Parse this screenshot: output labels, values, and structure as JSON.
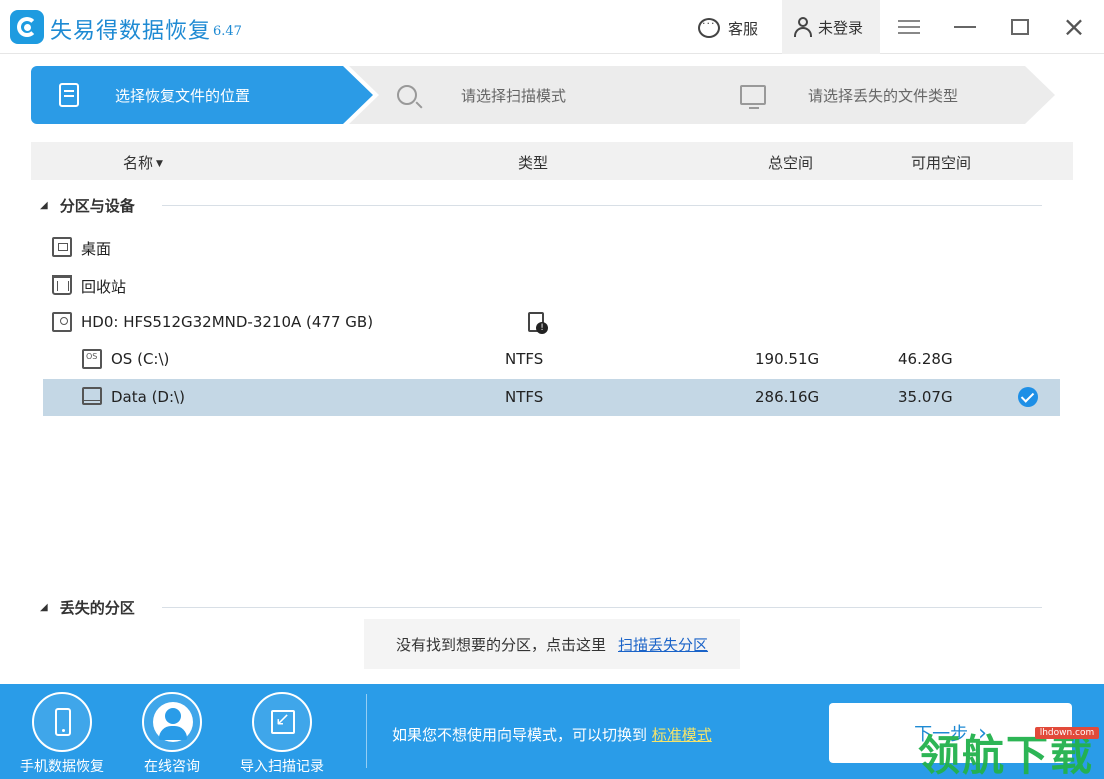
{
  "app": {
    "title": "失易得数据恢复",
    "version": "6.47",
    "service_label": "客服",
    "login_label": "未登录"
  },
  "steps": [
    {
      "label": "选择恢复文件的位置",
      "icon": "document-icon",
      "active": true
    },
    {
      "label": "请选择扫描模式",
      "icon": "magnifier-icon",
      "active": false
    },
    {
      "label": "请选择丢失的文件类型",
      "icon": "monitor-icon",
      "active": false
    }
  ],
  "table": {
    "headers": {
      "name": "名称",
      "type": "类型",
      "total": "总空间",
      "available": "可用空间"
    }
  },
  "sections": {
    "partitions": "分区与设备",
    "lost": "丢失的分区"
  },
  "rows": [
    {
      "name": "桌面",
      "icon": "desktop-icon",
      "type": "",
      "total": "",
      "available": ""
    },
    {
      "name": "回收站",
      "icon": "recycle-bin-icon",
      "type": "",
      "total": "",
      "available": ""
    },
    {
      "name": "HD0: HFS512G32MND-3210A (477 GB)",
      "icon": "hard-disk-icon",
      "type": "",
      "total": "",
      "available": ""
    },
    {
      "name": "OS (C:\\)",
      "icon": "os-drive-icon",
      "type": "NTFS",
      "total": "190.51G",
      "available": "46.28G"
    },
    {
      "name": "Data (D:\\)",
      "icon": "drive-icon",
      "type": "NTFS",
      "total": "286.16G",
      "available": "35.07G",
      "selected": true
    }
  ],
  "lost_hint": {
    "text": "没有找到想要的分区，点击这里",
    "link": "扫描丢失分区"
  },
  "bottom": {
    "buttons": [
      {
        "label": "手机数据恢复",
        "icon": "phone-icon"
      },
      {
        "label": "在线咨询",
        "icon": "agent-icon"
      },
      {
        "label": "导入扫描记录",
        "icon": "import-icon"
      }
    ],
    "hint_text": "如果您不想使用向导模式，可以切换到",
    "hint_link": "标准模式",
    "next_label": "下一步"
  },
  "watermark": {
    "text": "领航下载",
    "site": "lhdown.com"
  },
  "colors": {
    "accent": "#2a9ce8",
    "selected_row": "#c4d7e5",
    "link": "#1a63c8"
  }
}
